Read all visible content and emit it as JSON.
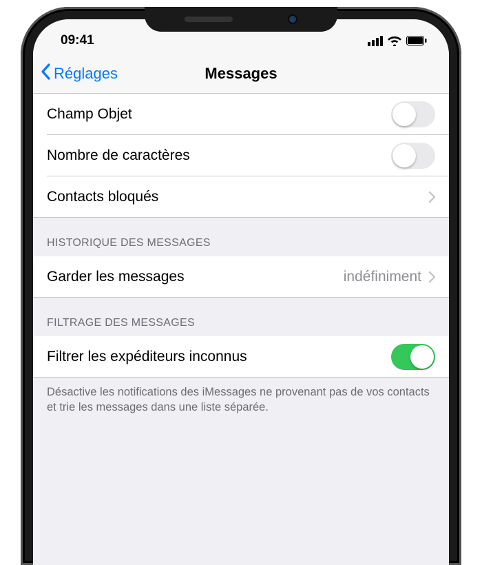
{
  "statusbar": {
    "time": "09:41"
  },
  "navbar": {
    "back": "Réglages",
    "title": "Messages"
  },
  "section1": {
    "subject": {
      "label": "Champ Objet",
      "on": false
    },
    "charcount": {
      "label": "Nombre de caractères",
      "on": false
    },
    "blocked": {
      "label": "Contacts bloqués"
    }
  },
  "section2": {
    "header": "HISTORIQUE DES MESSAGES",
    "keep": {
      "label": "Garder les messages",
      "value": "indéfiniment"
    }
  },
  "section3": {
    "header": "FILTRAGE DES MESSAGES",
    "filter": {
      "label": "Filtrer les expéditeurs inconnus",
      "on": true
    },
    "footer": "Désactive les notifications des iMessages ne provenant pas de vos contacts et trie les messages dans une liste séparée."
  },
  "colors": {
    "accent": "#007aff",
    "toggle_on": "#34c759"
  }
}
